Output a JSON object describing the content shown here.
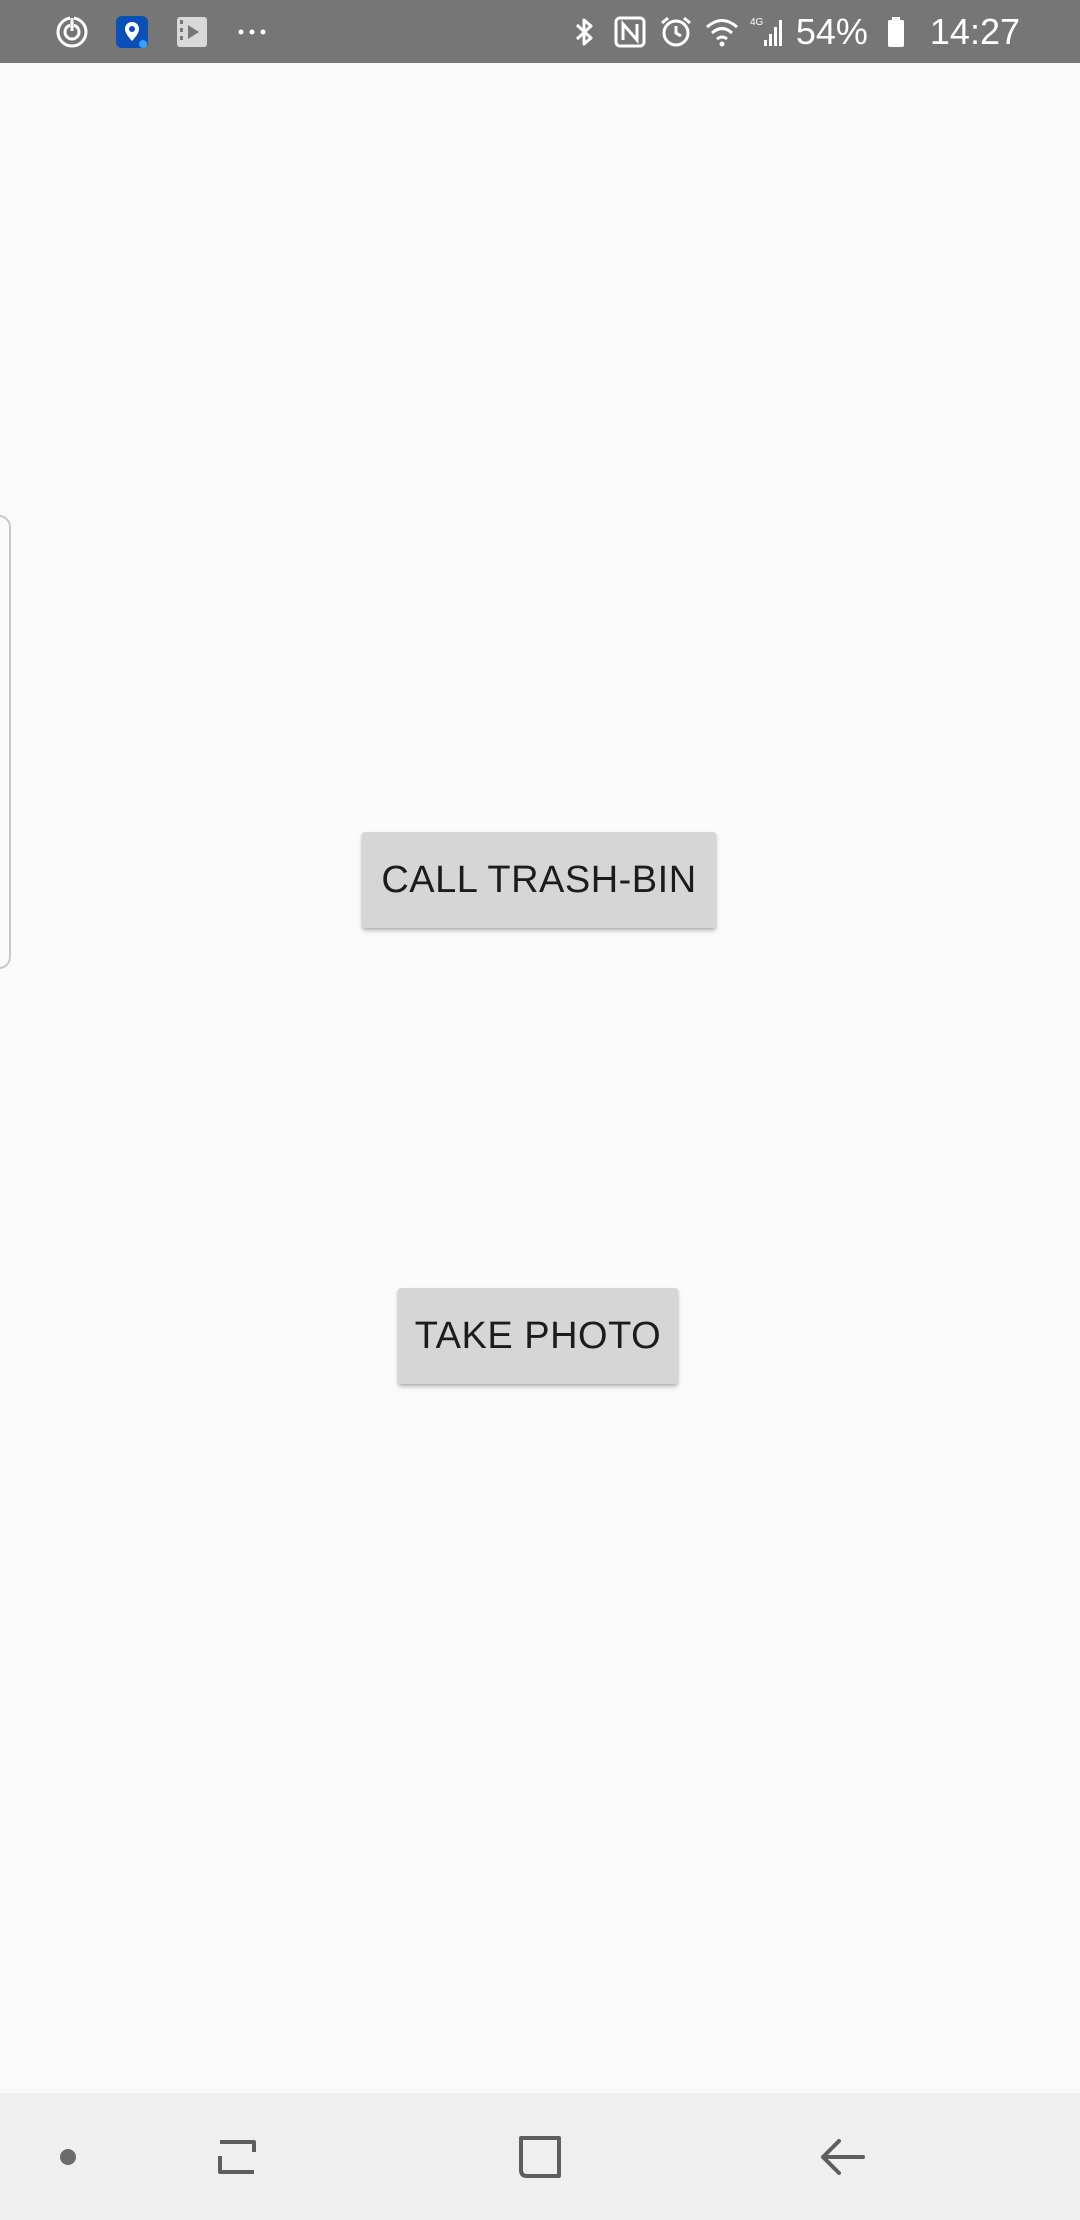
{
  "status_bar": {
    "left_icons": [
      "sync-icon",
      "location-app-icon",
      "video-icon",
      "more-dots-icon"
    ],
    "right_icons": [
      "bluetooth-icon",
      "nfc-icon",
      "alarm-icon",
      "wifi-icon",
      "4g-signal-icon"
    ],
    "network_label": "4G",
    "battery_percent": "54%",
    "time": "14:27",
    "bar_color": "#767676"
  },
  "main": {
    "buttons": {
      "call_trash_bin": "CALL TRASH-BIN",
      "take_photo": "TAKE PHOTO"
    },
    "background_color": "#fafafa",
    "button_color": "#d6d6d6"
  },
  "nav_bar": {
    "items": [
      "nav-dot-icon",
      "recents-icon",
      "home-icon",
      "back-icon"
    ],
    "background_color": "#efefef"
  }
}
